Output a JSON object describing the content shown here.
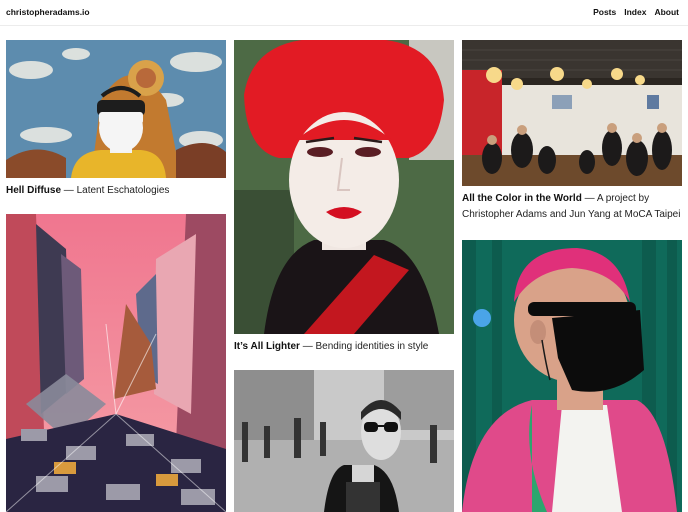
{
  "site": {
    "name": "christopheradams.io"
  },
  "nav": {
    "items": [
      "Posts",
      "Index",
      "About"
    ]
  },
  "posts": [
    {
      "title": "Hell Diffuse",
      "subtitle": "Latent Eschatologies",
      "image": "vr-headset-deity-painting"
    },
    {
      "title": "",
      "subtitle": "",
      "image": "fragmented-pink-cityscape"
    },
    {
      "title": "It’s All Lighter",
      "subtitle": "Bending identities in style",
      "image": "red-hair-portrait"
    },
    {
      "title": "",
      "subtitle": "",
      "image": "bw-street-portrait-sunglasses"
    },
    {
      "title": "All the Color in the World",
      "subtitle": "A project by Christopher Adams and Jun Yang at MoCA Taipei",
      "image": "gallery-event-crowd"
    },
    {
      "title": "",
      "subtitle": "",
      "image": "pink-hair-black-mask-portrait"
    }
  ],
  "separator": "—"
}
